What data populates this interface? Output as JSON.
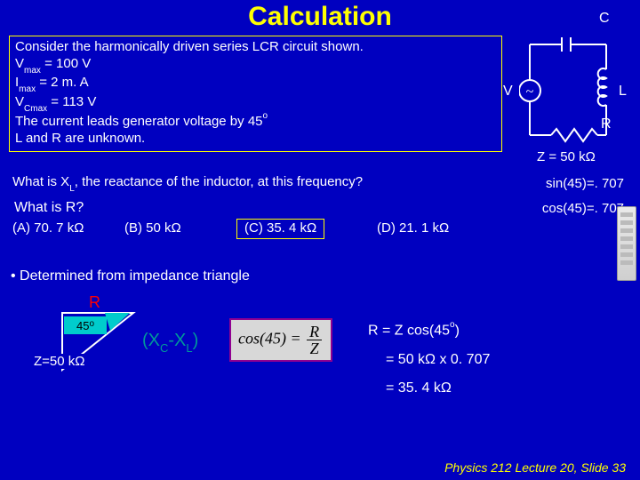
{
  "title": "Calculation",
  "problem": {
    "line1": "Consider the harmonically driven series LCR circuit shown.",
    "vmax_label": "V",
    "vmax_sub": "max",
    "vmax_rest": " = 100 V",
    "imax_label": "I",
    "imax_sub": "max",
    "imax_rest": " = 2 m. A",
    "vcmax_label": "V",
    "vcmax_sub": "Cmax",
    "vcmax_rest": " = 113 V",
    "phase1": "The current leads generator voltage by 45",
    "phase_sup": "o",
    "unknown": "L and R are unknown."
  },
  "question_xl_a": "What is X",
  "question_xl_sub": "L",
  "question_xl_b": ", the reactance of the inductor, at this frequency?",
  "what_r": "What is R?",
  "options": {
    "A": "(A)  70. 7 kΩ",
    "B": "(B)  50 kΩ",
    "C": "(C)  35. 4 kΩ",
    "D": "(D)  21. 1 kΩ"
  },
  "trig": {
    "sin": "sin(45)=. 707",
    "cos": "cos(45)=. 707"
  },
  "determined": "• Determined from impedance triangle",
  "triangle": {
    "R": "R",
    "angle": "45",
    "angle_sup": "o",
    "Zlabel": "Z=50 kΩ",
    "xcxl_a": "(X",
    "xcxl_c": "C",
    "xcxl_m": "-X",
    "xcxl_l": "L",
    "xcxl_b": ")"
  },
  "cosformula": {
    "lhs": "cos(45) = ",
    "num": "R",
    "den": "Z"
  },
  "work": {
    "line1a": "R = Z cos(45",
    "line1sup": "o",
    "line1b": ")",
    "line2": "= 50 kΩ x 0. 707",
    "line3": "= 35. 4 kΩ"
  },
  "circuit": {
    "C": "C",
    "V": "V",
    "L": "L",
    "R": "R",
    "Z": "Z = 50 kΩ",
    "ac": "~"
  },
  "footer": "Physics 212  Lecture 20, Slide  33"
}
